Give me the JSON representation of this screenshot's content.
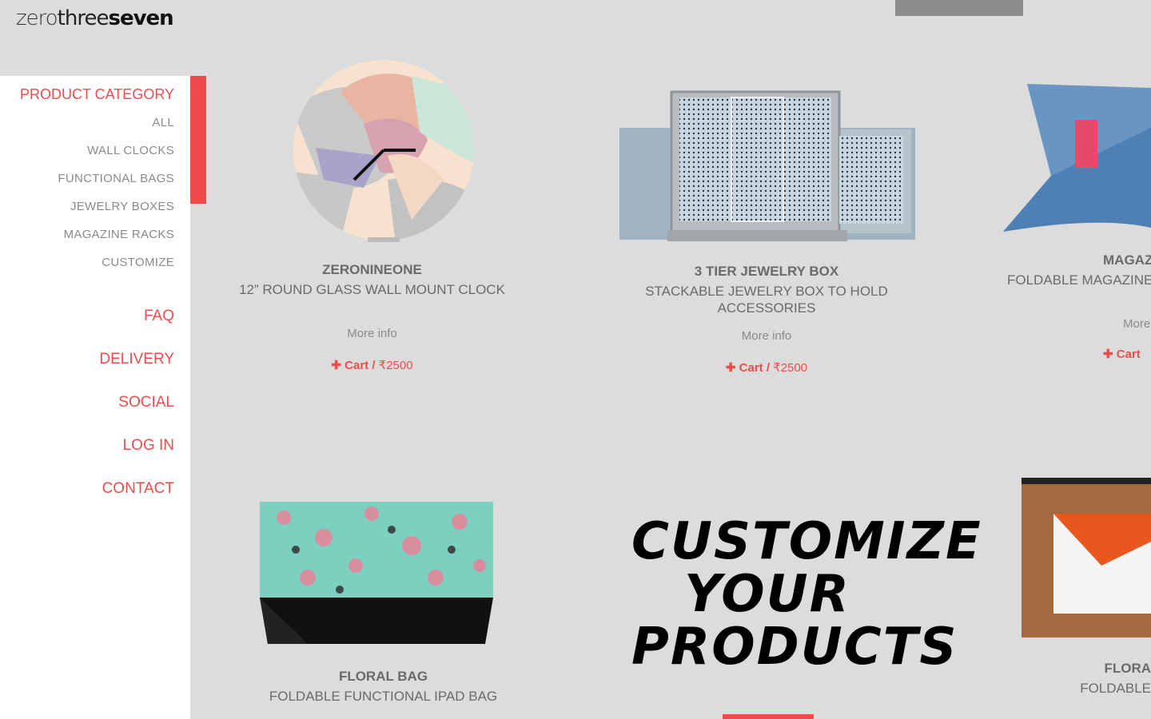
{
  "logo": {
    "part1": "zero",
    "part2": "three",
    "part3": "seven"
  },
  "sidebar": {
    "category_title": "PRODUCT CATEGORY",
    "categories": [
      "ALL",
      "WALL CLOCKS",
      "FUNCTIONAL BAGS",
      "JEWELRY BOXES",
      "MAGAZINE RACKS",
      "CUSTOMIZE"
    ],
    "nav": [
      "FAQ",
      "DELIVERY",
      "SOCIAL",
      "LOG IN",
      "CONTACT"
    ]
  },
  "products": [
    {
      "name": "ZERONINEONE",
      "desc": "12” ROUND GLASS WALL MOUNT CLOCK",
      "more": "More info",
      "cart": "Cart",
      "price": "₹2500"
    },
    {
      "name": "3 TIER JEWELRY BOX",
      "desc": "STACKABLE JEWELRY BOX TO HOLD ACCESSORIES",
      "more": "More info",
      "cart": "Cart",
      "price": "₹2500"
    },
    {
      "name": "MAGAZ",
      "desc": "FOLDABLE MAGAZINE",
      "more": "More",
      "cart": "Cart",
      "price": ""
    },
    {
      "name": "FLORAL BAG",
      "desc": "FOLDABLE FUNCTIONAL IPAD BAG"
    },
    {
      "name": "FLORA",
      "desc": "FOLDABLE"
    }
  ],
  "custom_banner": {
    "line1": "CUSTOMIZE",
    "line2": "YOUR",
    "line3": "PRODUCTS"
  },
  "colors": {
    "accent": "#f04a4a",
    "background": "#dcdcdc"
  }
}
